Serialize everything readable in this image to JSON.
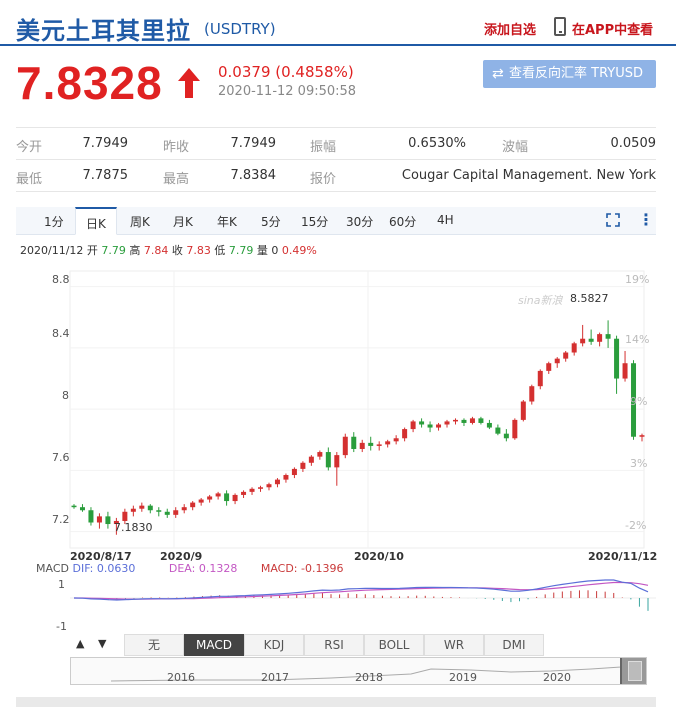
{
  "header": {
    "title": "美元土耳其里拉",
    "code": "(USDTRY)",
    "add_favorite": "添加自选",
    "app_view": "在APP中查看"
  },
  "quote": {
    "price": "7.8328",
    "change": "0.0379 (0.4858%)",
    "datetime": "2020-11-12 09:50:58",
    "reverse_button": "查看反向汇率 TRYUSD",
    "up_color": "#e02222"
  },
  "stats": {
    "row1": [
      {
        "label": "今开",
        "value": "7.7949"
      },
      {
        "label": "昨收",
        "value": "7.7949"
      },
      {
        "label": "振幅",
        "value": "0.6530%"
      },
      {
        "label": "波幅",
        "value": "0.0509"
      }
    ],
    "row2": [
      {
        "label": "最低",
        "value": "7.7875"
      },
      {
        "label": "最高",
        "value": "7.8384"
      },
      {
        "label": "报价",
        "value": "Cougar Capital Management. New York"
      }
    ]
  },
  "tabs": [
    "1分",
    "日K",
    "周K",
    "月K",
    "年K",
    "5分",
    "15分",
    "30分",
    "60分",
    "4H"
  ],
  "active_tab": "日K",
  "icons": {
    "fullscreen": "fullscreen-icon",
    "more": "more-vertical-icon",
    "phone": "phone-icon",
    "swap": "swap-icon",
    "arrow": "arrow-up-icon"
  },
  "ohlc_line": {
    "date": "2020/11/12",
    "open_label": "开",
    "open": "7.79",
    "high_label": "高",
    "high": "7.84",
    "close_label": "收",
    "close": "7.83",
    "low_label": "低",
    "low": "7.79",
    "volume_label": "量",
    "volume": "0",
    "pct": "0.49%"
  },
  "chart_data": {
    "type": "candlestick",
    "y_ticks": [
      "8.8",
      "8.4",
      "8",
      "7.6",
      "7.2"
    ],
    "ylim": [
      7.1,
      8.85
    ],
    "pct_ticks": [
      "19%",
      "14%",
      "9%",
      "3%",
      "-2%"
    ],
    "x_ticks": [
      "2020/8/17",
      "2020/9",
      "2020/10",
      "2020/11/12"
    ],
    "annotations": {
      "max": "8.5827",
      "min": "7.1830"
    },
    "watermark": "sina新浪",
    "up_color": "#d43030",
    "down_color": "#2a9d3c",
    "candles_ohlc": [
      [
        7.37,
        7.38,
        7.35,
        7.36
      ],
      [
        7.36,
        7.38,
        7.33,
        7.34
      ],
      [
        7.34,
        7.36,
        7.24,
        7.26
      ],
      [
        7.26,
        7.32,
        7.22,
        7.3
      ],
      [
        7.3,
        7.33,
        7.22,
        7.25
      ],
      [
        7.25,
        7.29,
        7.18,
        7.27
      ],
      [
        7.27,
        7.35,
        7.25,
        7.33
      ],
      [
        7.33,
        7.37,
        7.3,
        7.35
      ],
      [
        7.35,
        7.39,
        7.33,
        7.37
      ],
      [
        7.37,
        7.38,
        7.32,
        7.34
      ],
      [
        7.34,
        7.36,
        7.3,
        7.33
      ],
      [
        7.33,
        7.35,
        7.29,
        7.31
      ],
      [
        7.31,
        7.36,
        7.29,
        7.34
      ],
      [
        7.34,
        7.38,
        7.32,
        7.36
      ],
      [
        7.36,
        7.4,
        7.34,
        7.39
      ],
      [
        7.39,
        7.42,
        7.37,
        7.41
      ],
      [
        7.41,
        7.44,
        7.39,
        7.43
      ],
      [
        7.43,
        7.46,
        7.41,
        7.45
      ],
      [
        7.45,
        7.47,
        7.37,
        7.4
      ],
      [
        7.4,
        7.45,
        7.38,
        7.44
      ],
      [
        7.44,
        7.47,
        7.42,
        7.46
      ],
      [
        7.46,
        7.49,
        7.44,
        7.48
      ],
      [
        7.48,
        7.5,
        7.46,
        7.49
      ],
      [
        7.49,
        7.52,
        7.47,
        7.51
      ],
      [
        7.51,
        7.55,
        7.49,
        7.54
      ],
      [
        7.54,
        7.58,
        7.52,
        7.57
      ],
      [
        7.57,
        7.62,
        7.55,
        7.61
      ],
      [
        7.61,
        7.66,
        7.59,
        7.65
      ],
      [
        7.65,
        7.7,
        7.63,
        7.69
      ],
      [
        7.69,
        7.73,
        7.67,
        7.72
      ],
      [
        7.72,
        7.75,
        7.6,
        7.62
      ],
      [
        7.62,
        7.72,
        7.5,
        7.7
      ],
      [
        7.7,
        7.84,
        7.68,
        7.82
      ],
      [
        7.82,
        7.85,
        7.72,
        7.74
      ],
      [
        7.74,
        7.8,
        7.72,
        7.78
      ],
      [
        7.78,
        7.82,
        7.73,
        7.76
      ],
      [
        7.76,
        7.79,
        7.73,
        7.77
      ],
      [
        7.77,
        7.8,
        7.75,
        7.79
      ],
      [
        7.79,
        7.83,
        7.77,
        7.81
      ],
      [
        7.81,
        7.88,
        7.79,
        7.87
      ],
      [
        7.87,
        7.93,
        7.85,
        7.92
      ],
      [
        7.92,
        7.94,
        7.88,
        7.9
      ],
      [
        7.9,
        7.92,
        7.85,
        7.88
      ],
      [
        7.88,
        7.91,
        7.86,
        7.9
      ],
      [
        7.9,
        7.93,
        7.88,
        7.92
      ],
      [
        7.92,
        7.94,
        7.9,
        7.93
      ],
      [
        7.93,
        7.94,
        7.89,
        7.91
      ],
      [
        7.91,
        7.95,
        7.9,
        7.94
      ],
      [
        7.94,
        7.95,
        7.9,
        7.91
      ],
      [
        7.91,
        7.93,
        7.87,
        7.88
      ],
      [
        7.88,
        7.9,
        7.83,
        7.84
      ],
      [
        7.84,
        7.87,
        7.79,
        7.81
      ],
      [
        7.81,
        7.94,
        7.8,
        7.93
      ],
      [
        7.93,
        8.06,
        7.92,
        8.05
      ],
      [
        8.05,
        8.16,
        8.03,
        8.15
      ],
      [
        8.15,
        8.26,
        8.13,
        8.25
      ],
      [
        8.25,
        8.31,
        8.23,
        8.3
      ],
      [
        8.3,
        8.34,
        8.27,
        8.33
      ],
      [
        8.33,
        8.38,
        8.31,
        8.37
      ],
      [
        8.37,
        8.44,
        8.35,
        8.43
      ],
      [
        8.43,
        8.55,
        8.41,
        8.46
      ],
      [
        8.46,
        8.52,
        8.42,
        8.44
      ],
      [
        8.44,
        8.5,
        8.41,
        8.49
      ],
      [
        8.49,
        8.58,
        8.4,
        8.46
      ],
      [
        8.46,
        8.48,
        8.1,
        8.2
      ],
      [
        8.2,
        8.38,
        8.18,
        8.3
      ],
      [
        8.3,
        8.32,
        7.8,
        7.82
      ],
      [
        7.82,
        7.84,
        7.79,
        7.83
      ]
    ]
  },
  "macd": {
    "title": "MACD",
    "dif": "DIF: 0.0630",
    "dea": "DEA: 0.1328",
    "macd": "MACD: -0.1396",
    "ticks": [
      "1",
      "-1"
    ],
    "dif_color": "#5b6fd8",
    "dea_color": "#c357c3",
    "macd_color": "#c93a3a"
  },
  "nav": {
    "prev": "▲",
    "next": "▼"
  },
  "indicators": [
    "无",
    "MACD",
    "KDJ",
    "RSI",
    "BOLL",
    "WR",
    "DMI"
  ],
  "active_indicator": "MACD",
  "timeline_years": [
    "2016",
    "2017",
    "2018",
    "2019",
    "2020"
  ]
}
